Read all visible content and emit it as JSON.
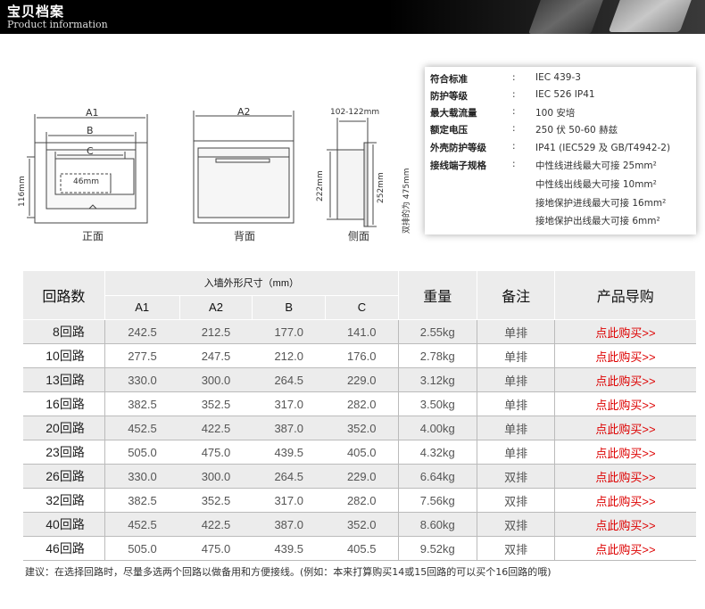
{
  "banner": {
    "title_cn": "宝贝档案",
    "title_en": "Product information"
  },
  "diagrams": {
    "front": {
      "caption": "正面",
      "dim_a1": "A1",
      "dim_b": "B",
      "dim_c": "C",
      "dim_height": "116mm",
      "dim_inner": "46mm"
    },
    "back": {
      "caption": "背面",
      "dim_a2": "A2"
    },
    "side": {
      "caption": "侧面",
      "dim_depth": "102-122mm",
      "dim_h1": "222mm",
      "dim_h2": "252mm",
      "dim_double": "双排的为 475mm"
    }
  },
  "specs": {
    "rows": [
      {
        "key": "符合标准",
        "colon": ":",
        "value": "IEC 439-3"
      },
      {
        "key": "防护等级",
        "colon": ":",
        "value": "IEC 526 IP41"
      },
      {
        "key": "最大载流量",
        "colon": ":",
        "value": "100 安培"
      },
      {
        "key": "额定电压",
        "colon": ":",
        "value": "250 伏 50-60 赫兹"
      },
      {
        "key": "外壳防护等级",
        "colon": ":",
        "value": "IP41 (IEC529 及 GB/T4942-2)"
      },
      {
        "key": "接线端子规格",
        "colon": ":",
        "value": "中性线进线最大可接 25mm²"
      }
    ],
    "extra_lines": [
      "中性线出线最大可接 10mm²",
      "接地保护进线最大可接 16mm²",
      "接地保护出线最大可接 6mm²"
    ]
  },
  "table": {
    "header": {
      "circuits": "回路数",
      "dims_group": "入墙外形尺寸（mm）",
      "a1": "A1",
      "a2": "A2",
      "b": "B",
      "c": "C",
      "weight": "重量",
      "remark": "备注",
      "guide": "产品导购"
    },
    "rows": [
      {
        "circuits": "8回路",
        "a1": "242.5",
        "a2": "212.5",
        "b": "177.0",
        "c": "141.0",
        "weight": "2.55kg",
        "remark": "单排",
        "buy": "点此购买>>"
      },
      {
        "circuits": "10回路",
        "a1": "277.5",
        "a2": "247.5",
        "b": "212.0",
        "c": "176.0",
        "weight": "2.78kg",
        "remark": "单排",
        "buy": "点此购买>>"
      },
      {
        "circuits": "13回路",
        "a1": "330.0",
        "a2": "300.0",
        "b": "264.5",
        "c": "229.0",
        "weight": "3.12kg",
        "remark": "单排",
        "buy": "点此购买>>"
      },
      {
        "circuits": "16回路",
        "a1": "382.5",
        "a2": "352.5",
        "b": "317.0",
        "c": "282.0",
        "weight": "3.50kg",
        "remark": "单排",
        "buy": "点此购买>>"
      },
      {
        "circuits": "20回路",
        "a1": "452.5",
        "a2": "422.5",
        "b": "387.0",
        "c": "352.0",
        "weight": "4.00kg",
        "remark": "单排",
        "buy": "点此购买>>"
      },
      {
        "circuits": "23回路",
        "a1": "505.0",
        "a2": "475.0",
        "b": "439.5",
        "c": "405.0",
        "weight": "4.32kg",
        "remark": "单排",
        "buy": "点此购买>>"
      },
      {
        "circuits": "26回路",
        "a1": "330.0",
        "a2": "300.0",
        "b": "264.5",
        "c": "229.0",
        "weight": "6.64kg",
        "remark": "双排",
        "buy": "点此购买>>"
      },
      {
        "circuits": "32回路",
        "a1": "382.5",
        "a2": "352.5",
        "b": "317.0",
        "c": "282.0",
        "weight": "7.56kg",
        "remark": "双排",
        "buy": "点此购买>>"
      },
      {
        "circuits": "40回路",
        "a1": "452.5",
        "a2": "422.5",
        "b": "387.0",
        "c": "352.0",
        "weight": "8.60kg",
        "remark": "双排",
        "buy": "点此购买>>"
      },
      {
        "circuits": "46回路",
        "a1": "505.0",
        "a2": "475.0",
        "b": "439.5",
        "c": "405.5",
        "weight": "9.52kg",
        "remark": "双排",
        "buy": "点此购买>>"
      }
    ]
  },
  "note": "建议：在选择回路时，尽量多选两个回路以做备用和方便接线。(例如：本来打算购买14或15回路的可以买个16回路的哦)"
}
